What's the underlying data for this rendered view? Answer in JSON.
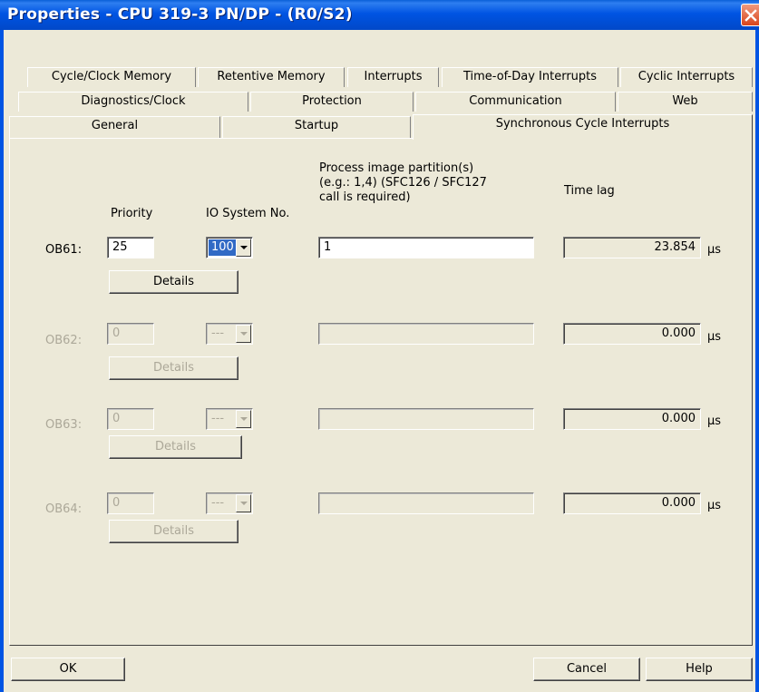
{
  "window": {
    "title": "Properties - CPU 319-3 PN/DP - (R0/S2)"
  },
  "tabs": {
    "row1": [
      "Cycle/Clock Memory",
      "Retentive Memory",
      "Interrupts",
      "Time-of-Day Interrupts",
      "Cyclic Interrupts"
    ],
    "row2": [
      "Diagnostics/Clock",
      "Protection",
      "Communication",
      "Web"
    ],
    "row3": [
      "General",
      "Startup",
      "Synchronous Cycle Interrupts"
    ],
    "active": "Synchronous Cycle Interrupts"
  },
  "columns": {
    "priority": "Priority",
    "io_system": "IO System No.",
    "process_image_1": "Process image partition(s)",
    "process_image_2": "(e.g.: 1,4) (SFC126 / SFC127",
    "process_image_3": "call is required)",
    "time_lag": "Time lag"
  },
  "rows": [
    {
      "label": "OB61:",
      "priority": "25",
      "io_system": "100",
      "process_image": "1",
      "time_lag": "23.854",
      "unit": "µs",
      "details": "Details",
      "enabled": true
    },
    {
      "label": "OB62:",
      "priority": "0",
      "io_system": "---",
      "process_image": "",
      "time_lag": "0.000",
      "unit": "µs",
      "details": "Details",
      "enabled": false
    },
    {
      "label": "OB63:",
      "priority": "0",
      "io_system": "---",
      "process_image": "",
      "time_lag": "0.000",
      "unit": "µs",
      "details": "Details",
      "enabled": false
    },
    {
      "label": "OB64:",
      "priority": "0",
      "io_system": "---",
      "process_image": "",
      "time_lag": "0.000",
      "unit": "µs",
      "details": "Details",
      "enabled": false
    }
  ],
  "footer": {
    "ok": "OK",
    "cancel": "Cancel",
    "help": "Help"
  },
  "icons": {
    "close": "close-icon"
  },
  "colors": {
    "titlebar": "#0054E3",
    "face": "#ECE9D8",
    "disabled_text": "#ACA899",
    "selection": "#316AC5"
  }
}
